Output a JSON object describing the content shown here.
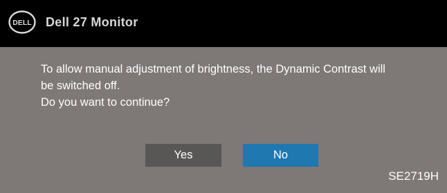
{
  "header": {
    "logo_text": "DELL",
    "title": "Dell  27 Monitor"
  },
  "dialog": {
    "message_lines": [
      "To allow manual adjustment of brightness, the Dynamic Contrast will",
      "be switched off.",
      "Do you want to continue?"
    ],
    "yes_label": "Yes",
    "no_label": "No",
    "model": "SE2719H"
  },
  "colors": {
    "header_background": "#000000",
    "body_background": "#7e7876",
    "yes_button": "#595756",
    "no_button_selected": "#1f78b0",
    "text": "#ffffff"
  },
  "selected_button": "No"
}
